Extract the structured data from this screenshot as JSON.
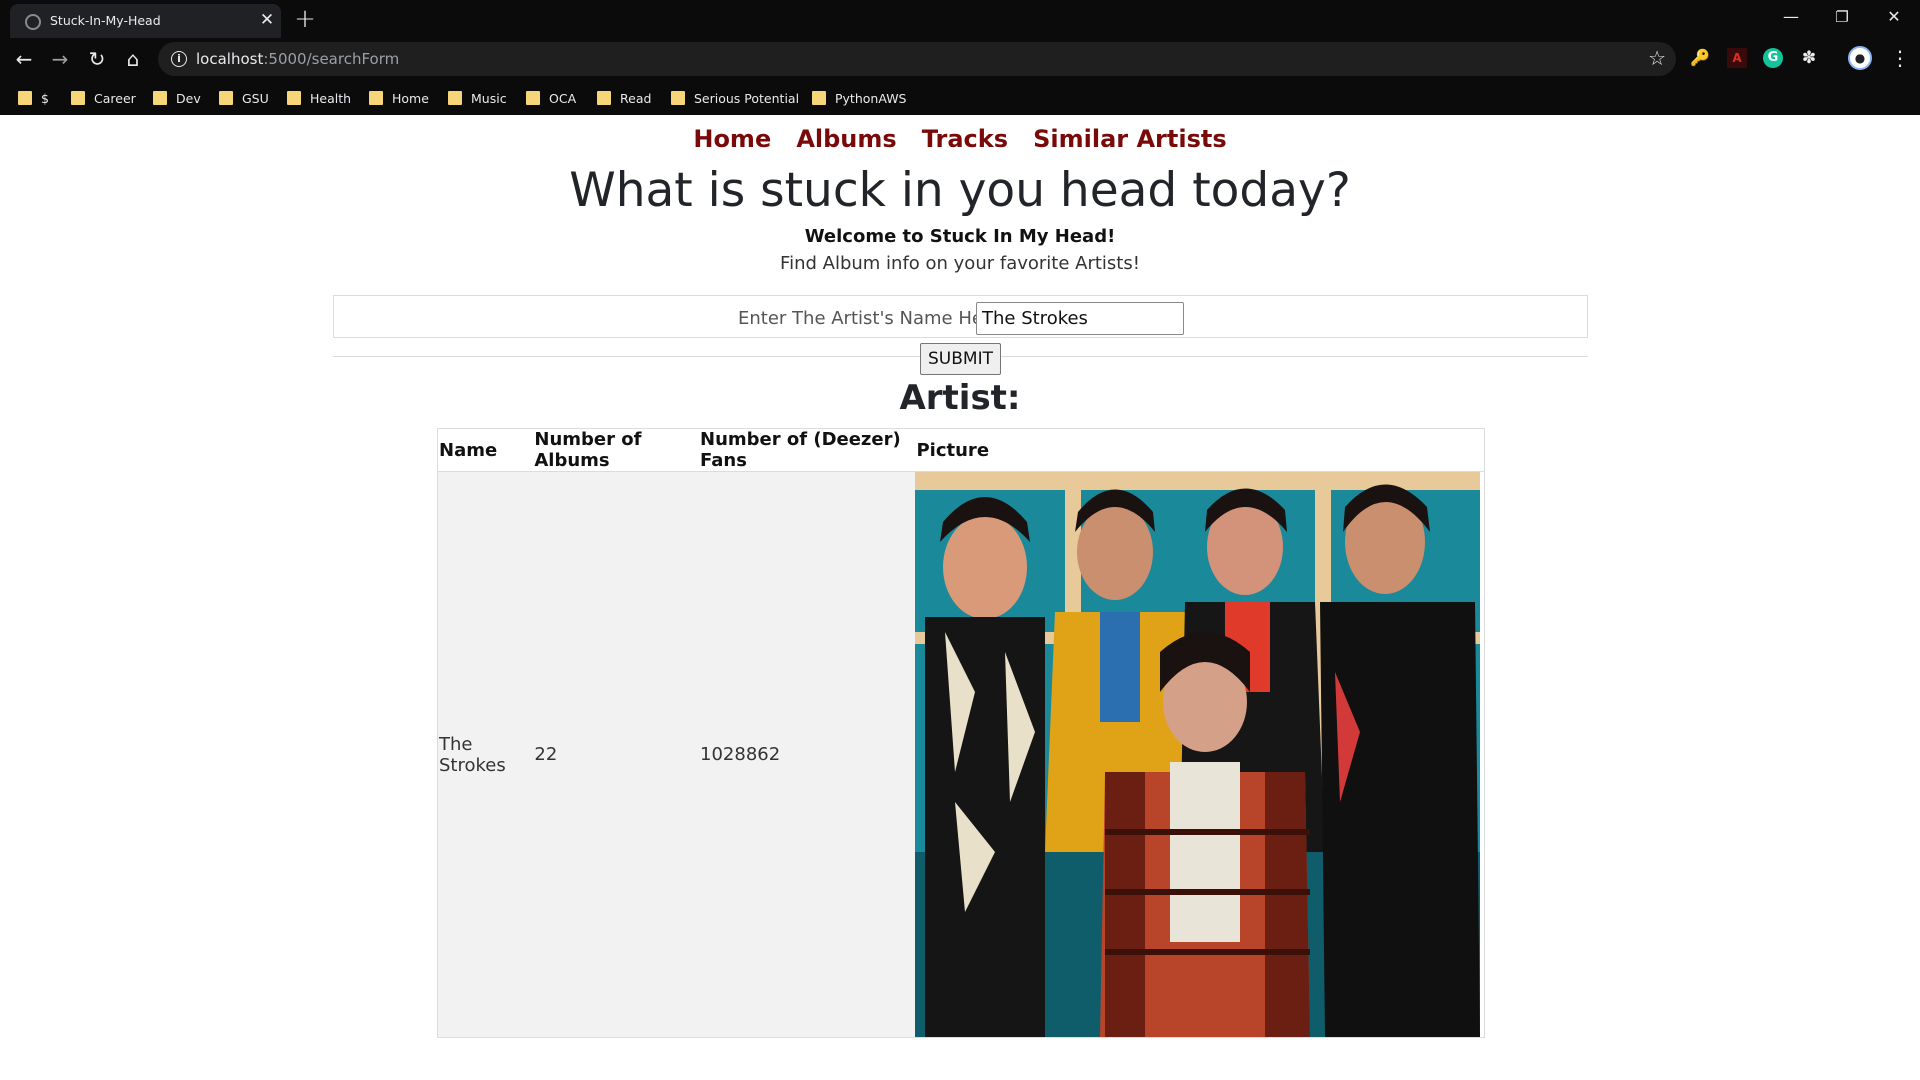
{
  "browser": {
    "tab_title": "Stuck-In-My-Head",
    "url_host": "localhost",
    "url_path": ":5000/searchForm",
    "bookmarks": [
      "$",
      "Career",
      "Dev",
      "GSU",
      "Health",
      "Home",
      "Music",
      "OCA",
      "Read",
      "Serious Potential",
      "PythonAWS"
    ]
  },
  "nav": {
    "items": [
      "Home",
      "Albums",
      "Tracks",
      "Similar Artists"
    ]
  },
  "hero": {
    "headline": "What is stuck in you head today?",
    "welcome": "Welcome to Stuck In My Head!",
    "subtext": "Find Album info on your favorite Artists!"
  },
  "form": {
    "label": "Enter The Artist's Name Here:",
    "value": "The Strokes",
    "submit_label": "SUBMIT"
  },
  "result": {
    "heading": "Artist:",
    "columns": [
      "Name",
      "Number of Albums",
      "Number of (Deezer) Fans",
      "Picture"
    ],
    "row": {
      "name": "The Strokes",
      "albums": "22",
      "fans": "1028862"
    }
  },
  "colors": {
    "nav_link": "#7a0a0a",
    "chrome_bg": "#0b0b0b",
    "folder": "#f6d679"
  }
}
